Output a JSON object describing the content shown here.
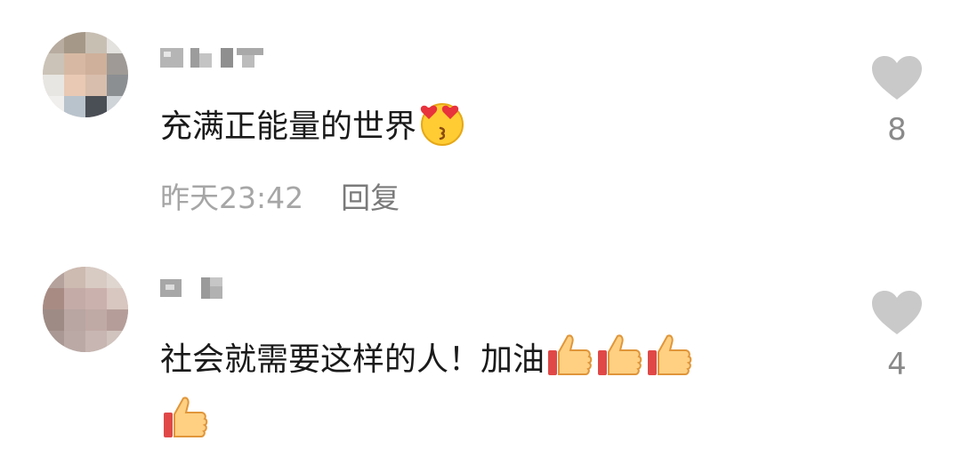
{
  "comments": [
    {
      "text": "充满正能量的世界",
      "emoji": "heart-eyes-kiss-emoji",
      "time": "昨天23:42",
      "reply_label": "回复",
      "likes": "8"
    },
    {
      "text": "社会就需要这样的人！加油",
      "emoji": "thumbs-up-emoji",
      "time": "",
      "reply_label": "",
      "likes": "4"
    }
  ],
  "colors": {
    "text": "#1a1a1a",
    "meta": "#a6a6a6",
    "reply": "#7a7a7a",
    "heart": "#c9c9c9",
    "count": "#8a8a8a"
  }
}
